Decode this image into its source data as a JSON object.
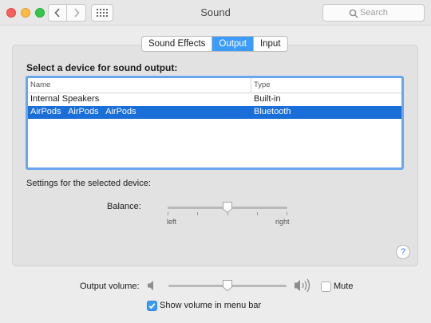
{
  "window": {
    "title": "Sound",
    "search_placeholder": "Search"
  },
  "tabs": [
    {
      "label": "Sound Effects",
      "active": false
    },
    {
      "label": "Output",
      "active": true
    },
    {
      "label": "Input",
      "active": false
    }
  ],
  "output": {
    "select_label": "Select a device for sound output:",
    "columns": [
      "Name",
      "Type"
    ],
    "devices": [
      {
        "name": "Internal Speakers",
        "type": "Built-in",
        "selected": false
      },
      {
        "name": "AirPods   AirPods   AirPods",
        "type": "Bluetooth",
        "selected": true
      }
    ],
    "settings_label": "Settings for the selected device:",
    "balance": {
      "label": "Balance:",
      "left_label": "left",
      "right_label": "right",
      "value": 0.5
    }
  },
  "volume": {
    "label": "Output volume:",
    "value": 0.5,
    "mute_label": "Mute",
    "mute_checked": false,
    "menubar_label": "Show volume in menu bar",
    "menubar_checked": true
  },
  "help": {
    "label": "?"
  },
  "colors": {
    "accent": "#3c9bfb",
    "selection": "#1a6ed8"
  },
  "icons": {
    "search": "search-icon",
    "speaker_low": "speaker-low-icon",
    "speaker_high": "speaker-high-icon",
    "grid": "grid-icon"
  }
}
